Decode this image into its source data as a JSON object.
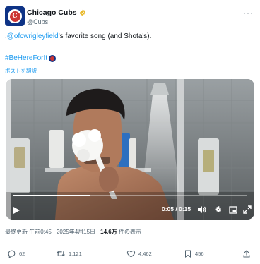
{
  "tweet": {
    "author": {
      "display_name": "Chicago Cubs",
      "handle": "@Cubs",
      "avatar_letter": "C"
    },
    "more_label": "···",
    "text": {
      "prefix": ".",
      "mention": "@ofcwrigleyfield",
      "suffix": "'s favorite song (and Shota's)."
    },
    "hashtag": "#BeHereForIt",
    "translate_label": "ポストを翻訳",
    "video": {
      "time_display": "0:05 / 0:15",
      "progress": 0.33
    },
    "meta": {
      "edited_label": "最終更新 午前0:45",
      "dot1": " · ",
      "date": "2025年4月15日",
      "dot2": " · ",
      "views": "14.6万",
      "views_suffix": " 件の表示"
    },
    "actions": {
      "replies": "62",
      "retweets": "1,121",
      "likes": "4,462",
      "bookmarks": "456"
    }
  },
  "colors": {
    "link": "#1d9bf0",
    "brand_blue": "#0e3386",
    "brand_red": "#cc3433",
    "muted": "#536471"
  }
}
